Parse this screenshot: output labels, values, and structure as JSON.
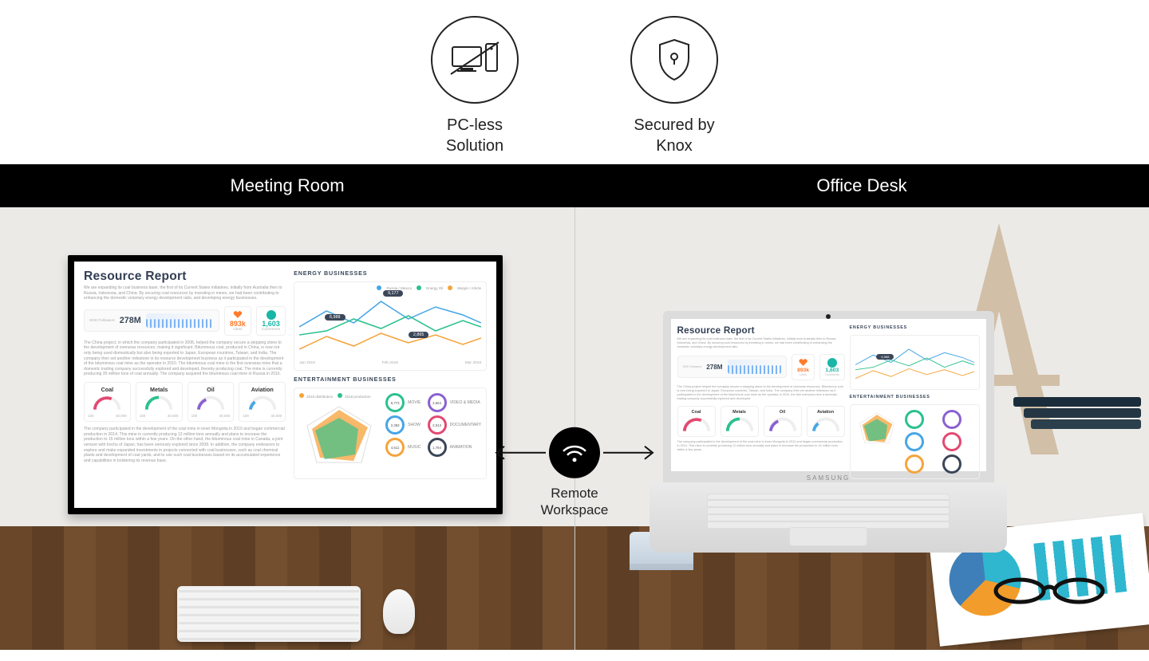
{
  "features": [
    {
      "id": "pcless",
      "label": "PC-less\nSolution"
    },
    {
      "id": "knox",
      "label": "Secured by\nKnox"
    }
  ],
  "titlebar": {
    "left": "Meeting Room",
    "right": "Office Desk"
  },
  "remote": {
    "label": "Remote\nWorkspace"
  },
  "laptop_brand": "SAMSUNG",
  "report": {
    "title": "Resource Report",
    "followers": {
      "label": "SNS Followers",
      "value": "278M"
    },
    "likes": {
      "value": "893k",
      "label": "Likes"
    },
    "comments": {
      "value": "1,603",
      "label": "Comments"
    },
    "gauges": [
      {
        "name": "Coal",
        "color": "#e24971",
        "value_left": "100",
        "value_right": "40,000"
      },
      {
        "name": "Metals",
        "color": "#2bc18d",
        "value_left": "100",
        "value_right": "40,000"
      },
      {
        "name": "Oil",
        "color": "#8a61d1",
        "value_left": "100",
        "value_right": "40,000"
      },
      {
        "name": "Aviation",
        "color": "#47a6e6",
        "value_left": "100",
        "value_right": "40,000"
      }
    ],
    "energy": {
      "title": "ENERGY BUSINESSES",
      "legend": [
        "Russia / Mexico",
        "Energy Oil",
        "Margin / Article"
      ],
      "pills": {
        "a": "9,177",
        "b": "6,988",
        "c": "2,865"
      },
      "x": [
        "Jan 2018",
        "Feb 2018",
        "Mar 2018"
      ]
    },
    "entertainment": {
      "title": "ENTERTAINMENT BUSINESSES",
      "legend": [
        "2016 distribution",
        "2018 production"
      ],
      "ring_col_a": [
        {
          "label": "MOVIE",
          "value": "6,773"
        },
        {
          "label": "SHOW",
          "value": "2,383"
        },
        {
          "label": "MUSIC",
          "value": "4,511"
        }
      ],
      "ring_col_b": [
        {
          "label": "VIDEO & MEDIA",
          "value": "2,664"
        },
        {
          "label": "DOCUMENTARY",
          "value": "2,913"
        },
        {
          "label": "ANIMATION",
          "value": "1,784"
        }
      ]
    }
  },
  "chart_data": {
    "type": "line",
    "title": "ENERGY BUSINESSES",
    "x": [
      "Jan 2018",
      "Feb 2018",
      "Mar 2018"
    ],
    "series": [
      {
        "name": "Russia / Mexico",
        "values": [
          6988,
          9177,
          7800
        ]
      },
      {
        "name": "Energy Oil",
        "values": [
          4200,
          5100,
          4600
        ]
      },
      {
        "name": "Margin / Article",
        "values": [
          3100,
          2865,
          3400
        ]
      }
    ],
    "annotations": [
      9177,
      6988,
      2865
    ],
    "xlabel": "",
    "ylabel": "",
    "ylim": [
      0,
      10000
    ]
  }
}
